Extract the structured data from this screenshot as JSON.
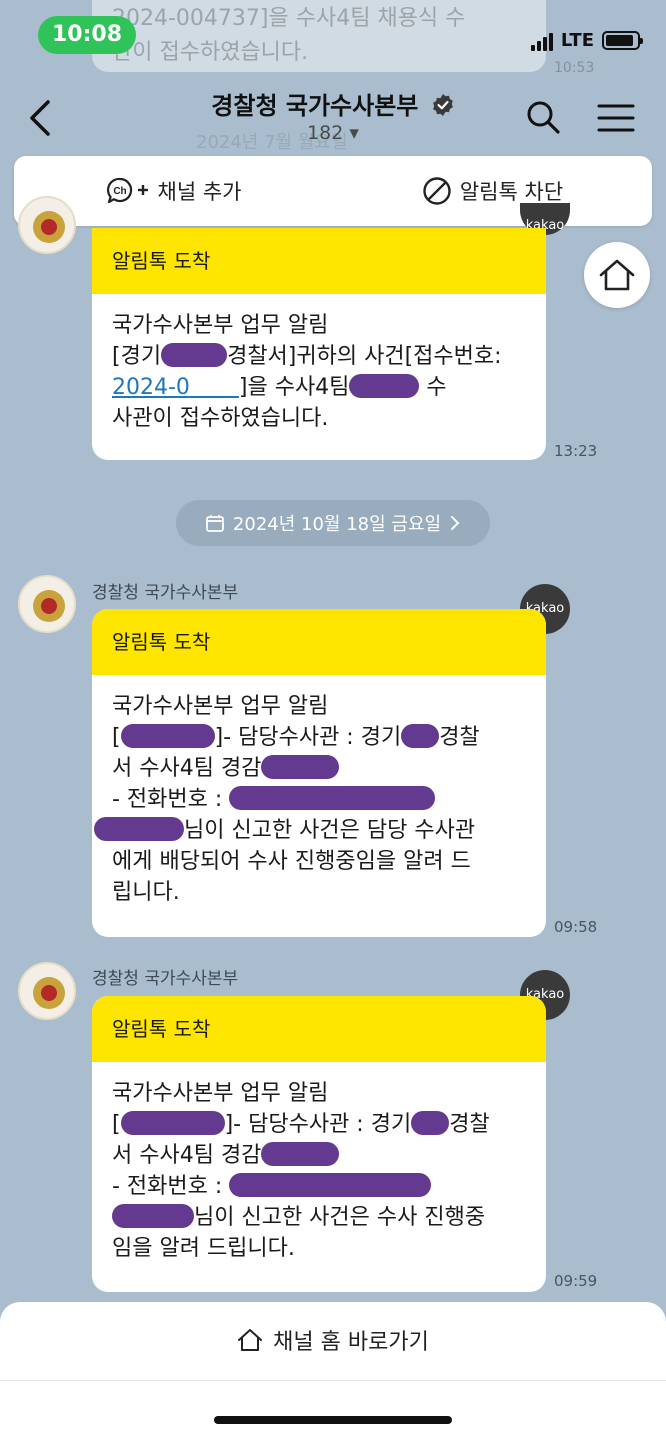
{
  "status": {
    "time": "10:08",
    "network": "LTE"
  },
  "faded_prev": {
    "line1": "2024-004737]을 수사4팀 채용식 수",
    "line2": "관이 접수하였습니다.",
    "time": "10:53"
  },
  "header": {
    "title": "경찰청 국가수사본부",
    "subtitle": "182 ▾",
    "ghost_date": "2024년 7월 월요일"
  },
  "channel_bar": {
    "add_label": "채널 추가",
    "block_label": "알림톡 차단"
  },
  "messages": [
    {
      "head": "알림톡 도착",
      "l1": "국가수사본부 업무 알림",
      "l2a": "[경기",
      "l2b": "경찰서]귀하의 사건[접수번호:",
      "l3a": "2024-0",
      "l3b": "]을 수사4팀",
      "l3c": " 수",
      "l4": "사관이 접수하였습니다.",
      "time": "13:23"
    },
    {
      "sender": "경찰청 국가수사본부",
      "badge": "kakao",
      "head": "알림톡 도착",
      "l1": "국가수사본부 업무 알림",
      "l2a": "[",
      "l2b": "]- 담당수사관 : 경기",
      "l2c": "경찰",
      "l3": "서 수사4팀 경감",
      "l4": "- 전화번호 : ",
      "l5": "님이 신고한 사건은 담당 수사관",
      "l6": "에게 배당되어 수사 진행중임을 알려 드",
      "l7": "립니다.",
      "time": "09:58"
    },
    {
      "sender": "경찰청 국가수사본부",
      "badge": "kakao",
      "head": "알림톡 도착",
      "l1": "국가수사본부 업무 알림",
      "l2a": "[",
      "l2b": "]- 담당수사관 : 경기",
      "l2c": "경찰",
      "l3": "서 수사4팀 경감",
      "l4": "- 전화번호 : ",
      "l5": "님이 신고한 사건은 수사 진행중",
      "l6": "임을 알려 드립니다.",
      "time": "09:59"
    }
  ],
  "date_divider": "2024년 10월 18일 금요일",
  "bottom": {
    "home_label": "채널 홈 바로가기"
  }
}
